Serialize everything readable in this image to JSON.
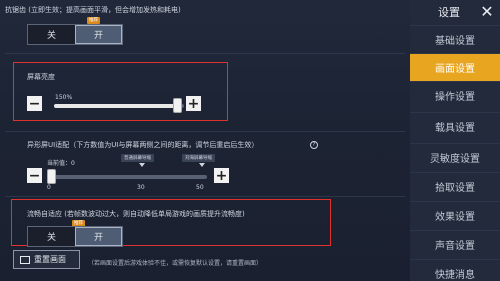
{
  "main": {
    "anti_lag": {
      "label": "抗锯齿 (立即生效；提高画面平滑，但会增加发热和耗电)",
      "off": "关",
      "on": "开",
      "badge": "推荐"
    },
    "brightness": {
      "label": "屏幕亮度",
      "value_text": "150%",
      "fraction": 0.95
    },
    "ui_adapt": {
      "label": "异形屏UI适配（下方数值为UI与屏幕两侧之间的距离，调节后重启后生效）",
      "help": "?",
      "current": "当前值：0",
      "tag_30": "普通屏幕导缩",
      "tag_50": "刘海屏幕导缩",
      "ticks": [
        "0",
        "30",
        "50"
      ],
      "fraction": 0.0
    },
    "smooth_adapt": {
      "label": "流畅自适应 (若帧数波动过大，则自动降低单局游戏的画质提升流畅度)",
      "off": "关",
      "on": "开",
      "badge": "推荐"
    },
    "reset": {
      "label": "重置画面",
      "note": "（若画面设置后游戏体验不佳，或需恢复默认设置，请重置画面）"
    }
  },
  "sidebar": {
    "title": "设置",
    "close": "✕",
    "items": [
      {
        "label": "基础设置"
      },
      {
        "label": "画面设置"
      },
      {
        "label": "操作设置"
      },
      {
        "label": "载具设置"
      },
      {
        "label": "灵敏度设置"
      },
      {
        "label": "拾取设置"
      },
      {
        "label": "效果设置"
      },
      {
        "label": "声音设置"
      },
      {
        "label": "快捷消息"
      }
    ],
    "active_index": 1
  },
  "colors": {
    "accent": "#e8a51f",
    "highlight_box": "#e0312e",
    "background": "#1b2130"
  }
}
